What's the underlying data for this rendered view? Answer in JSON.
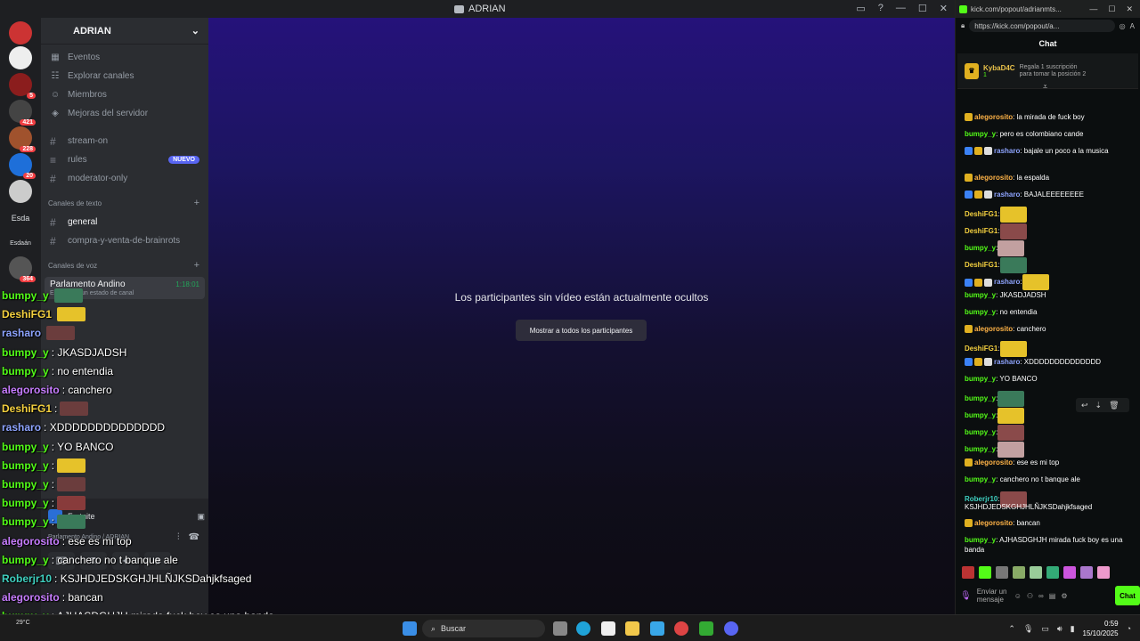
{
  "discord": {
    "window_title": "ADRIAN",
    "server_name": "ADRIAN",
    "nav": [
      "Eventos",
      "Explorar canales",
      "Miembros",
      "Mejoras del servidor"
    ],
    "channels_top": [
      "stream-on",
      "rules",
      "moderator-only"
    ],
    "new_badge": "NUEVO",
    "text_category": "Canales de texto",
    "text_channels": [
      "general",
      "compra-y-venta-de-brainrots"
    ],
    "voice_category": "Canales de voz",
    "voice_channel": {
      "name": "Parlamento Andino",
      "status": "Establecer un estado de canal",
      "time": "1:18:01"
    },
    "server_labels": [
      "Esda",
      "Esdaán"
    ],
    "server_badges": [
      "5",
      "421",
      "228",
      "20",
      "364"
    ],
    "game_activity": "Fortnite",
    "voice_footer": "Parlamento Andino / ADRIAN",
    "stage_message": "Los participantes sin vídeo están actualmente ocultos",
    "stage_button": "Mostrar a todos los participantes"
  },
  "overlay": [
    {
      "name": "bumpy_y",
      "text": ""
    },
    {
      "name": "DeshiFG1",
      "text": ""
    },
    {
      "name": "rasharo",
      "text": ""
    },
    {
      "name": "bumpy_y",
      "text": ": JKASDJADSH"
    },
    {
      "name": "bumpy_y",
      "text": ": no entendia"
    },
    {
      "name": "alegorosito",
      "text": ": canchero"
    },
    {
      "name": "DeshiFG1",
      "text": ":"
    },
    {
      "name": "rasharo",
      "text": ": XDDDDDDDDDDDDDD"
    },
    {
      "name": "bumpy_y",
      "text": ": YO      BANCO"
    },
    {
      "name": "bumpy_y",
      "text": ":"
    },
    {
      "name": "bumpy_y",
      "text": ":"
    },
    {
      "name": "bumpy_y",
      "text": ":"
    },
    {
      "name": "bumpy_y",
      "text": ":"
    },
    {
      "name": "alegorosito",
      "text": ": ese es mi top"
    },
    {
      "name": "bumpy_y",
      "text": ": cancher​o no t banque ale"
    },
    {
      "name": "Roberjr10",
      "text": ": KSJHDJEDSKGHJHLÑJKSDahjkfsaged"
    },
    {
      "name": "alegorosito",
      "text": ": bancan"
    },
    {
      "name": "bumpy_y",
      "text": ": AJHASDGHJH mirada fuck boy es una banda"
    }
  ],
  "browser": {
    "tab_title": "kick.com/popout/adrianmts...",
    "url": "https://kick.com/popout/a...",
    "chat_header": "Chat",
    "pinned_user": "KybaD4C",
    "pinned_count": "1",
    "pinned_text": "Regala 1 suscripción para tomar la posición 2",
    "input_placeholder": "Enviar un mensaje",
    "chat_button": "Chat"
  },
  "chat": [
    {
      "name": "alegorosito",
      "cls": "n-o",
      "text": ": la mirada de fuck boy"
    },
    {
      "name": "bumpy_y",
      "cls": "n-g",
      "text": ": pero es colombiano cande"
    },
    {
      "name": "rasharo",
      "cls": "n-b",
      "text": ": bajale un poco a la musica"
    },
    {
      "name": "alegorosito",
      "cls": "n-o",
      "text": ": la espalda"
    },
    {
      "name": "rasharo",
      "cls": "n-b",
      "text": ": BAJALEEEEEEEE"
    },
    {
      "name": "DeshiFG1",
      "cls": "n-y",
      "text": ":"
    },
    {
      "name": "DeshiFG1",
      "cls": "n-y",
      "text": ":"
    },
    {
      "name": "bumpy_y",
      "cls": "n-g",
      "text": ":"
    },
    {
      "name": "DeshiFG1",
      "cls": "n-y",
      "text": ":"
    },
    {
      "name": "rasharo",
      "cls": "n-b",
      "text": ":"
    },
    {
      "name": "bumpy_y",
      "cls": "n-g",
      "text": ": JKASDJADSH"
    },
    {
      "name": "bumpy_y",
      "cls": "n-g",
      "text": ": no entendia"
    },
    {
      "name": "alegorosito",
      "cls": "n-o",
      "text": ": canchero"
    },
    {
      "name": "DeshiFG1",
      "cls": "n-y",
      "text": ":"
    },
    {
      "name": "rasharo",
      "cls": "n-b",
      "text": ": XDDDDDDDDDDDDDD"
    },
    {
      "name": "bumpy_y",
      "cls": "n-g",
      "text": ": YO        BANCO"
    },
    {
      "name": "bumpy_y",
      "cls": "n-g",
      "text": ":"
    },
    {
      "name": "bumpy_y",
      "cls": "n-g",
      "text": ":"
    },
    {
      "name": "bumpy_y",
      "cls": "n-g",
      "text": ":"
    },
    {
      "name": "bumpy_y",
      "cls": "n-g",
      "text": ":"
    },
    {
      "name": "alegorosito",
      "cls": "n-o",
      "text": ": ese es mi top"
    },
    {
      "name": "bumpy_y",
      "cls": "n-g",
      "text": ": canchero no t banque ale"
    },
    {
      "name": "Roberjr10",
      "cls": "n-c",
      "text": ":"
    },
    {
      "name": "",
      "cls": "",
      "text": "KSJHDJEDSKGHJHLÑJKSDahjkfsaged"
    },
    {
      "name": "alegorosito",
      "cls": "n-o",
      "text": ": bancan"
    },
    {
      "name": "bumpy_y",
      "cls": "n-g",
      "text": ": AJHASDGHJH mirada fuck boy es una banda"
    }
  ],
  "taskbar": {
    "search": "Buscar",
    "temp": "29°C",
    "time": "0:59",
    "date": "15/10/2025"
  },
  "colors": {
    "kick_green": "#53fc18",
    "discord_blurple": "#5865f2"
  }
}
